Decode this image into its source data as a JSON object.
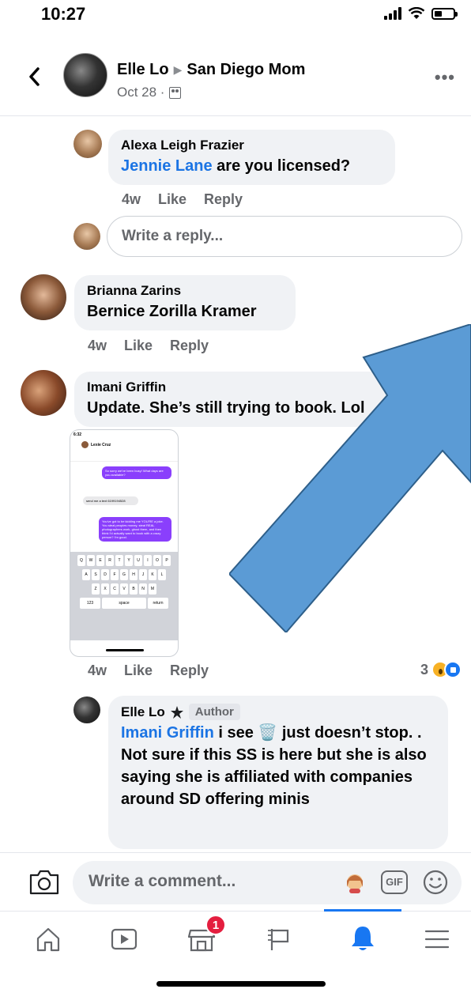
{
  "status_bar": {
    "time": "10:27"
  },
  "post_header": {
    "author": "Elle Lo",
    "group": "San Diego Mom",
    "date": "Oct 28 ·"
  },
  "comments": [
    {
      "author": "Alexa Leigh Frazier",
      "mention": "Jennie Lane",
      "text": " are you licensed?",
      "time": "4w",
      "like_label": "Like",
      "reply_label": "Reply"
    },
    {
      "author": "Brianna Zarins",
      "text": "Bernice Zorilla Kramer",
      "time": "4w",
      "like_label": "Like",
      "reply_label": "Reply"
    },
    {
      "author": "Imani Griffin",
      "text": "Update. She’s still trying to book. Lol",
      "time": "4w",
      "like_label": "Like",
      "reply_label": "Reply",
      "reaction_count": "3",
      "attachment": {
        "time": "6:32",
        "contact": "Lexie Cruz",
        "messages": [
          {
            "dir": "out",
            "text": "So sorry we've been busy! What days are you available?"
          },
          {
            "dir": "in",
            "text": "send me a text 6199194528"
          },
          {
            "dir": "out",
            "text": "You've got to be kidding me YOU'RE a joke. You steal peoples money, steal REAL photographers work, ghost them, and then think I'd actually want to book with a crazy person? I'm good."
          }
        ],
        "keyboard_rows": [
          [
            "Q",
            "W",
            "E",
            "R",
            "T",
            "Y",
            "U",
            "I",
            "O",
            "P"
          ],
          [
            "A",
            "S",
            "D",
            "F",
            "G",
            "H",
            "J",
            "K",
            "L"
          ],
          [
            "Z",
            "X",
            "C",
            "V",
            "B",
            "N",
            "M"
          ]
        ],
        "space_label": "space",
        "return_label": "return",
        "numbers_label": "123"
      }
    },
    {
      "author": "Elle Lo",
      "author_badge": "Author",
      "mention": "Imani Griffin",
      "text": " i see 🗑️ just doesn’t stop. . Not sure if this SS is here but she is also saying she is affiliated with companies around SD offering minis"
    }
  ],
  "reply_box": {
    "placeholder": "Write a reply..."
  },
  "composer": {
    "placeholder": "Write a comment...",
    "gif_label": "GIF"
  },
  "tabbar": {
    "tabs": [
      "home",
      "watch",
      "marketplace",
      "pages",
      "notifications",
      "menu"
    ],
    "active": "notifications",
    "marketplace_badge": "1"
  },
  "colors": {
    "link": "#1b74e4",
    "bubble": "#f0f2f5",
    "active_tab": "#1877f2",
    "badge": "#e41e3f",
    "overlay_arrow": "#5b9bd5"
  }
}
